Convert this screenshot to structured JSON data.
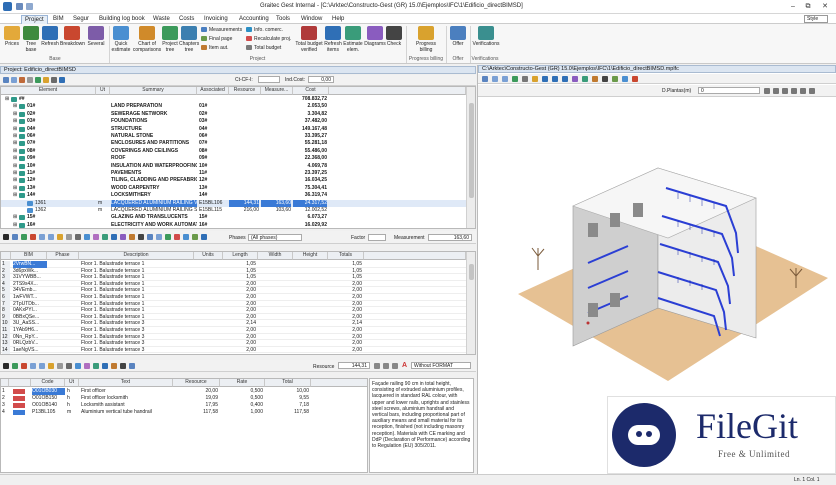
{
  "window": {
    "title": "Graitec Gest Internal - [C:\\Arktec\\Constructo-Gest (GR) 15.0\\Ejemplos\\IFC\\1\\Edificio_directBIMSD]",
    "min": "–",
    "max": "▫",
    "restore": "⧉",
    "close": "✕"
  },
  "menu": {
    "items": [
      "Project",
      "BIM",
      "Segur",
      "Building log book",
      "Waste",
      "Costs",
      "Invoicing",
      "Accounting",
      "Tools",
      "Window",
      "Help"
    ],
    "active": "Project",
    "style_label": "Style"
  },
  "ribbon": {
    "buttons": [
      "Prices",
      "Tree base",
      "Refresh",
      "Breakdown",
      "Several",
      "Quick estimate",
      "Chart of comparisons",
      "Project tree",
      "Chapters tree",
      "Total budget verified",
      "Refresh items",
      "Estimate elem.",
      "Diagrams",
      "Check",
      "Progress billing",
      "Offer",
      "Verifications"
    ],
    "small": [
      "Measurements",
      "Final page",
      "Item aut.",
      "Info. comerc.",
      "Recalculate proj.",
      "Total budget"
    ],
    "groups": [
      "Base",
      "Project",
      "Progress billing",
      "Offer",
      "Verifications"
    ]
  },
  "project_panel": {
    "title": "Project: Edificio_directBIMSD",
    "ct_label": "Ct-CF-I:",
    "ind_cost_label": "Ind.Cost:",
    "ind_cost_value": "0,00",
    "headers": [
      "Element",
      "Ut",
      "Summary",
      "Associated",
      "Resource",
      "Measure...",
      "Cost"
    ],
    "rows": [
      {
        "code": "##",
        "ut": "",
        "summary": "",
        "assoc": "",
        "res": "",
        "meas": "",
        "cost": "708.832,72",
        "lvl": 0,
        "bold": true
      },
      {
        "code": "01#",
        "ut": "",
        "summary": "LAND PREPARATION",
        "assoc": "01#",
        "res": "",
        "meas": "",
        "cost": "2.053,50",
        "lvl": 1,
        "bold": true
      },
      {
        "code": "02#",
        "ut": "",
        "summary": "SEWERAGE NETWORK",
        "assoc": "02#",
        "res": "",
        "meas": "",
        "cost": "3.304,82",
        "lvl": 1,
        "bold": true
      },
      {
        "code": "03#",
        "ut": "",
        "summary": "FOUNDATIONS",
        "assoc": "03#",
        "res": "",
        "meas": "",
        "cost": "37.482,00",
        "lvl": 1,
        "bold": true
      },
      {
        "code": "04#",
        "ut": "",
        "summary": "STRUCTURE",
        "assoc": "04#",
        "res": "",
        "meas": "",
        "cost": "149.167,48",
        "lvl": 1,
        "bold": true
      },
      {
        "code": "06#",
        "ut": "",
        "summary": "NATURAL STONE",
        "assoc": "06#",
        "res": "",
        "meas": "",
        "cost": "33.395,27",
        "lvl": 1,
        "bold": true
      },
      {
        "code": "07#",
        "ut": "",
        "summary": "ENCLOSURES AND PARTITIONS",
        "assoc": "07#",
        "res": "",
        "meas": "",
        "cost": "55.281,18",
        "lvl": 1,
        "bold": true
      },
      {
        "code": "08#",
        "ut": "",
        "summary": "COVERINGS AND CEILINGS",
        "assoc": "08#",
        "res": "",
        "meas": "",
        "cost": "55.486,00",
        "lvl": 1,
        "bold": true
      },
      {
        "code": "09#",
        "ut": "",
        "summary": "ROOF",
        "assoc": "09#",
        "res": "",
        "meas": "",
        "cost": "22.368,00",
        "lvl": 1,
        "bold": true
      },
      {
        "code": "10#",
        "ut": "",
        "summary": "INSULATION AND WATERPROOFING",
        "assoc": "10#",
        "res": "",
        "meas": "",
        "cost": "4.069,78",
        "lvl": 1,
        "bold": true
      },
      {
        "code": "11#",
        "ut": "",
        "summary": "PAVEMENTS",
        "assoc": "11#",
        "res": "",
        "meas": "",
        "cost": "23.397,25",
        "lvl": 1,
        "bold": true
      },
      {
        "code": "12#",
        "ut": "",
        "summary": "TILING, CLADDING AND PREFABRIC...",
        "assoc": "12#",
        "res": "",
        "meas": "",
        "cost": "16.034,25",
        "lvl": 1,
        "bold": true
      },
      {
        "code": "13#",
        "ut": "",
        "summary": "WOOD CARPENTRY",
        "assoc": "13#",
        "res": "",
        "meas": "",
        "cost": "75.304,41",
        "lvl": 1,
        "bold": true
      },
      {
        "code": "14#",
        "ut": "",
        "summary": "LOCKSMITHERY",
        "assoc": "14#",
        "res": "",
        "meas": "",
        "cost": "36.319,74",
        "lvl": 1,
        "bold": true
      },
      {
        "code": "1361",
        "ut": "m",
        "summary": "LACQUERED ALUMINIUM RAILING V...",
        "assoc": "E15BL106",
        "res": "144,31",
        "meas": "163,60",
        "cost": "24.317,52",
        "lvl": 2,
        "bold": false,
        "selected": true
      },
      {
        "code": "1362",
        "ut": "m",
        "summary": "LACQUERED ALUMINIUM RAILING STA...",
        "assoc": "E15BL115",
        "res": "216,00",
        "meas": "103,60",
        "cost": "12.002,52",
        "lvl": 2,
        "bold": false
      },
      {
        "code": "15#",
        "ut": "",
        "summary": "GLAZING AND TRANSLUCENTS",
        "assoc": "15#",
        "res": "",
        "meas": "",
        "cost": "6.073,27",
        "lvl": 1,
        "bold": true
      },
      {
        "code": "16#",
        "ut": "",
        "summary": "ELECTRICITY AND WORK AUTOMAT...",
        "assoc": "16#",
        "res": "",
        "meas": "",
        "cost": "16.029,92",
        "lvl": 1,
        "bold": true
      }
    ]
  },
  "measure_panel": {
    "phases_label": "Phases",
    "phases_value": "(All phases)",
    "factor_label": "Factor",
    "measurement_label": "Measurement",
    "measurement_value": "163,60",
    "headers": [
      "BIM",
      "Phase",
      "Description",
      "Units",
      "Length",
      "Width",
      "Height",
      "Totals"
    ],
    "rows": [
      {
        "bim": "2VrwBN...",
        "desc": "Floor 1. Balustrade terrace 1",
        "len": "1,05",
        "tot": "1,05"
      },
      {
        "bim": "3d6pxWk...",
        "desc": "Floor 1. Balustrade terrace 1",
        "len": "1,05",
        "tot": "1,05"
      },
      {
        "bim": "31VYWBB...",
        "desc": "Floor 1. Balustrade terrace 1",
        "len": "1,05",
        "tot": "1,05"
      },
      {
        "bim": "2TS9s4X...",
        "desc": "Floor 1. Balustrade terrace 1",
        "len": "2,00",
        "tot": "2,00"
      },
      {
        "bim": "34VErnb...",
        "desc": "Floor 1. Balustrade terrace 1",
        "len": "2,00",
        "tot": "2,00"
      },
      {
        "bim": "1wFVWT...",
        "desc": "Floor 1. Balustrade terrace 1",
        "len": "2,00",
        "tot": "2,00"
      },
      {
        "bim": "2TpUTDb...",
        "desc": "Floor 1. Balustrade terrace 1",
        "len": "2,00",
        "tot": "2,00"
      },
      {
        "bim": "0AKxPYl...",
        "desc": "Floor 1. Balustrade terrace 1",
        "len": "2,00",
        "tot": "2,00"
      },
      {
        "bim": "0BBxQSe...",
        "desc": "Floor 1. Balustrade terrace 1",
        "len": "2,00",
        "tot": "2,00"
      },
      {
        "bim": "3U_AaSS...",
        "desc": "Floor 1. Balustrade terrace 3",
        "len": "2,14",
        "tot": "2,14"
      },
      {
        "bim": "1YAb9H6...",
        "desc": "Floor 1. Balustrade terrace 3",
        "len": "2,00",
        "tot": "2,00"
      },
      {
        "bim": "0Nn_RpY...",
        "desc": "Floor 1. Balustrade terrace 3",
        "len": "2,00",
        "tot": "2,00"
      },
      {
        "bim": "0RLQzbV...",
        "desc": "Floor 1. Balustrade terrace 3",
        "len": "2,00",
        "tot": "2,00"
      },
      {
        "bim": "1aeNgVS...",
        "desc": "Floor 1. Balustrade terrace 3",
        "len": "2,00",
        "tot": "2,00"
      }
    ]
  },
  "resource_panel": {
    "resource_label": "Resource",
    "resource_value": "144,31",
    "format_value": "Without FORMAT",
    "headers": [
      "Code",
      "Ut",
      "Text",
      "Resource",
      "Rate",
      "Total"
    ],
    "rows": [
      {
        "code": "O01OB030",
        "ut": "h",
        "text": "First officer",
        "res": "20,00",
        "rate": "0,500",
        "total": "10,00"
      },
      {
        "code": "O01OB150",
        "ut": "h",
        "text": "First officer locksmith",
        "res": "19,09",
        "rate": "0,500",
        "total": "9,55"
      },
      {
        "code": "O01OB140",
        "ut": "h",
        "text": "Locksmith assistant",
        "res": "17,95",
        "rate": "0,400",
        "total": "7,18"
      },
      {
        "code": "P13BL105",
        "ut": "m",
        "text": "Aluminium vertical tube handrail",
        "res": "117,58",
        "rate": "1,000",
        "total": "117,58"
      }
    ],
    "description": "Façade railing 90 cm in total height, consisting of extruded aluminium profiles, lacquered in standard RAL colour, with upper and lower rails, uprights and stainless steel screws, aluminium handrail and vertical bars, including proportional part of auxiliary means and small material for its reception, finished (not including masonry reception). Materials with CE marking and DdP (Declaration of Performance) according to Regulation (EU) 305/2011."
  },
  "viewer": {
    "title": "C:\\Arktec\\Constructo-Gest (GR) 15.0\\Ejemplos\\IFC\\1\\Edificio_directBIMSD.mplfc",
    "plane_label": "D.Plantas(m)",
    "plane_value": "0"
  },
  "watermark": {
    "brand": "FileGit",
    "tagline": "Free & Unlimited"
  },
  "status": {
    "position": "Ln. 1   Col. 1"
  }
}
